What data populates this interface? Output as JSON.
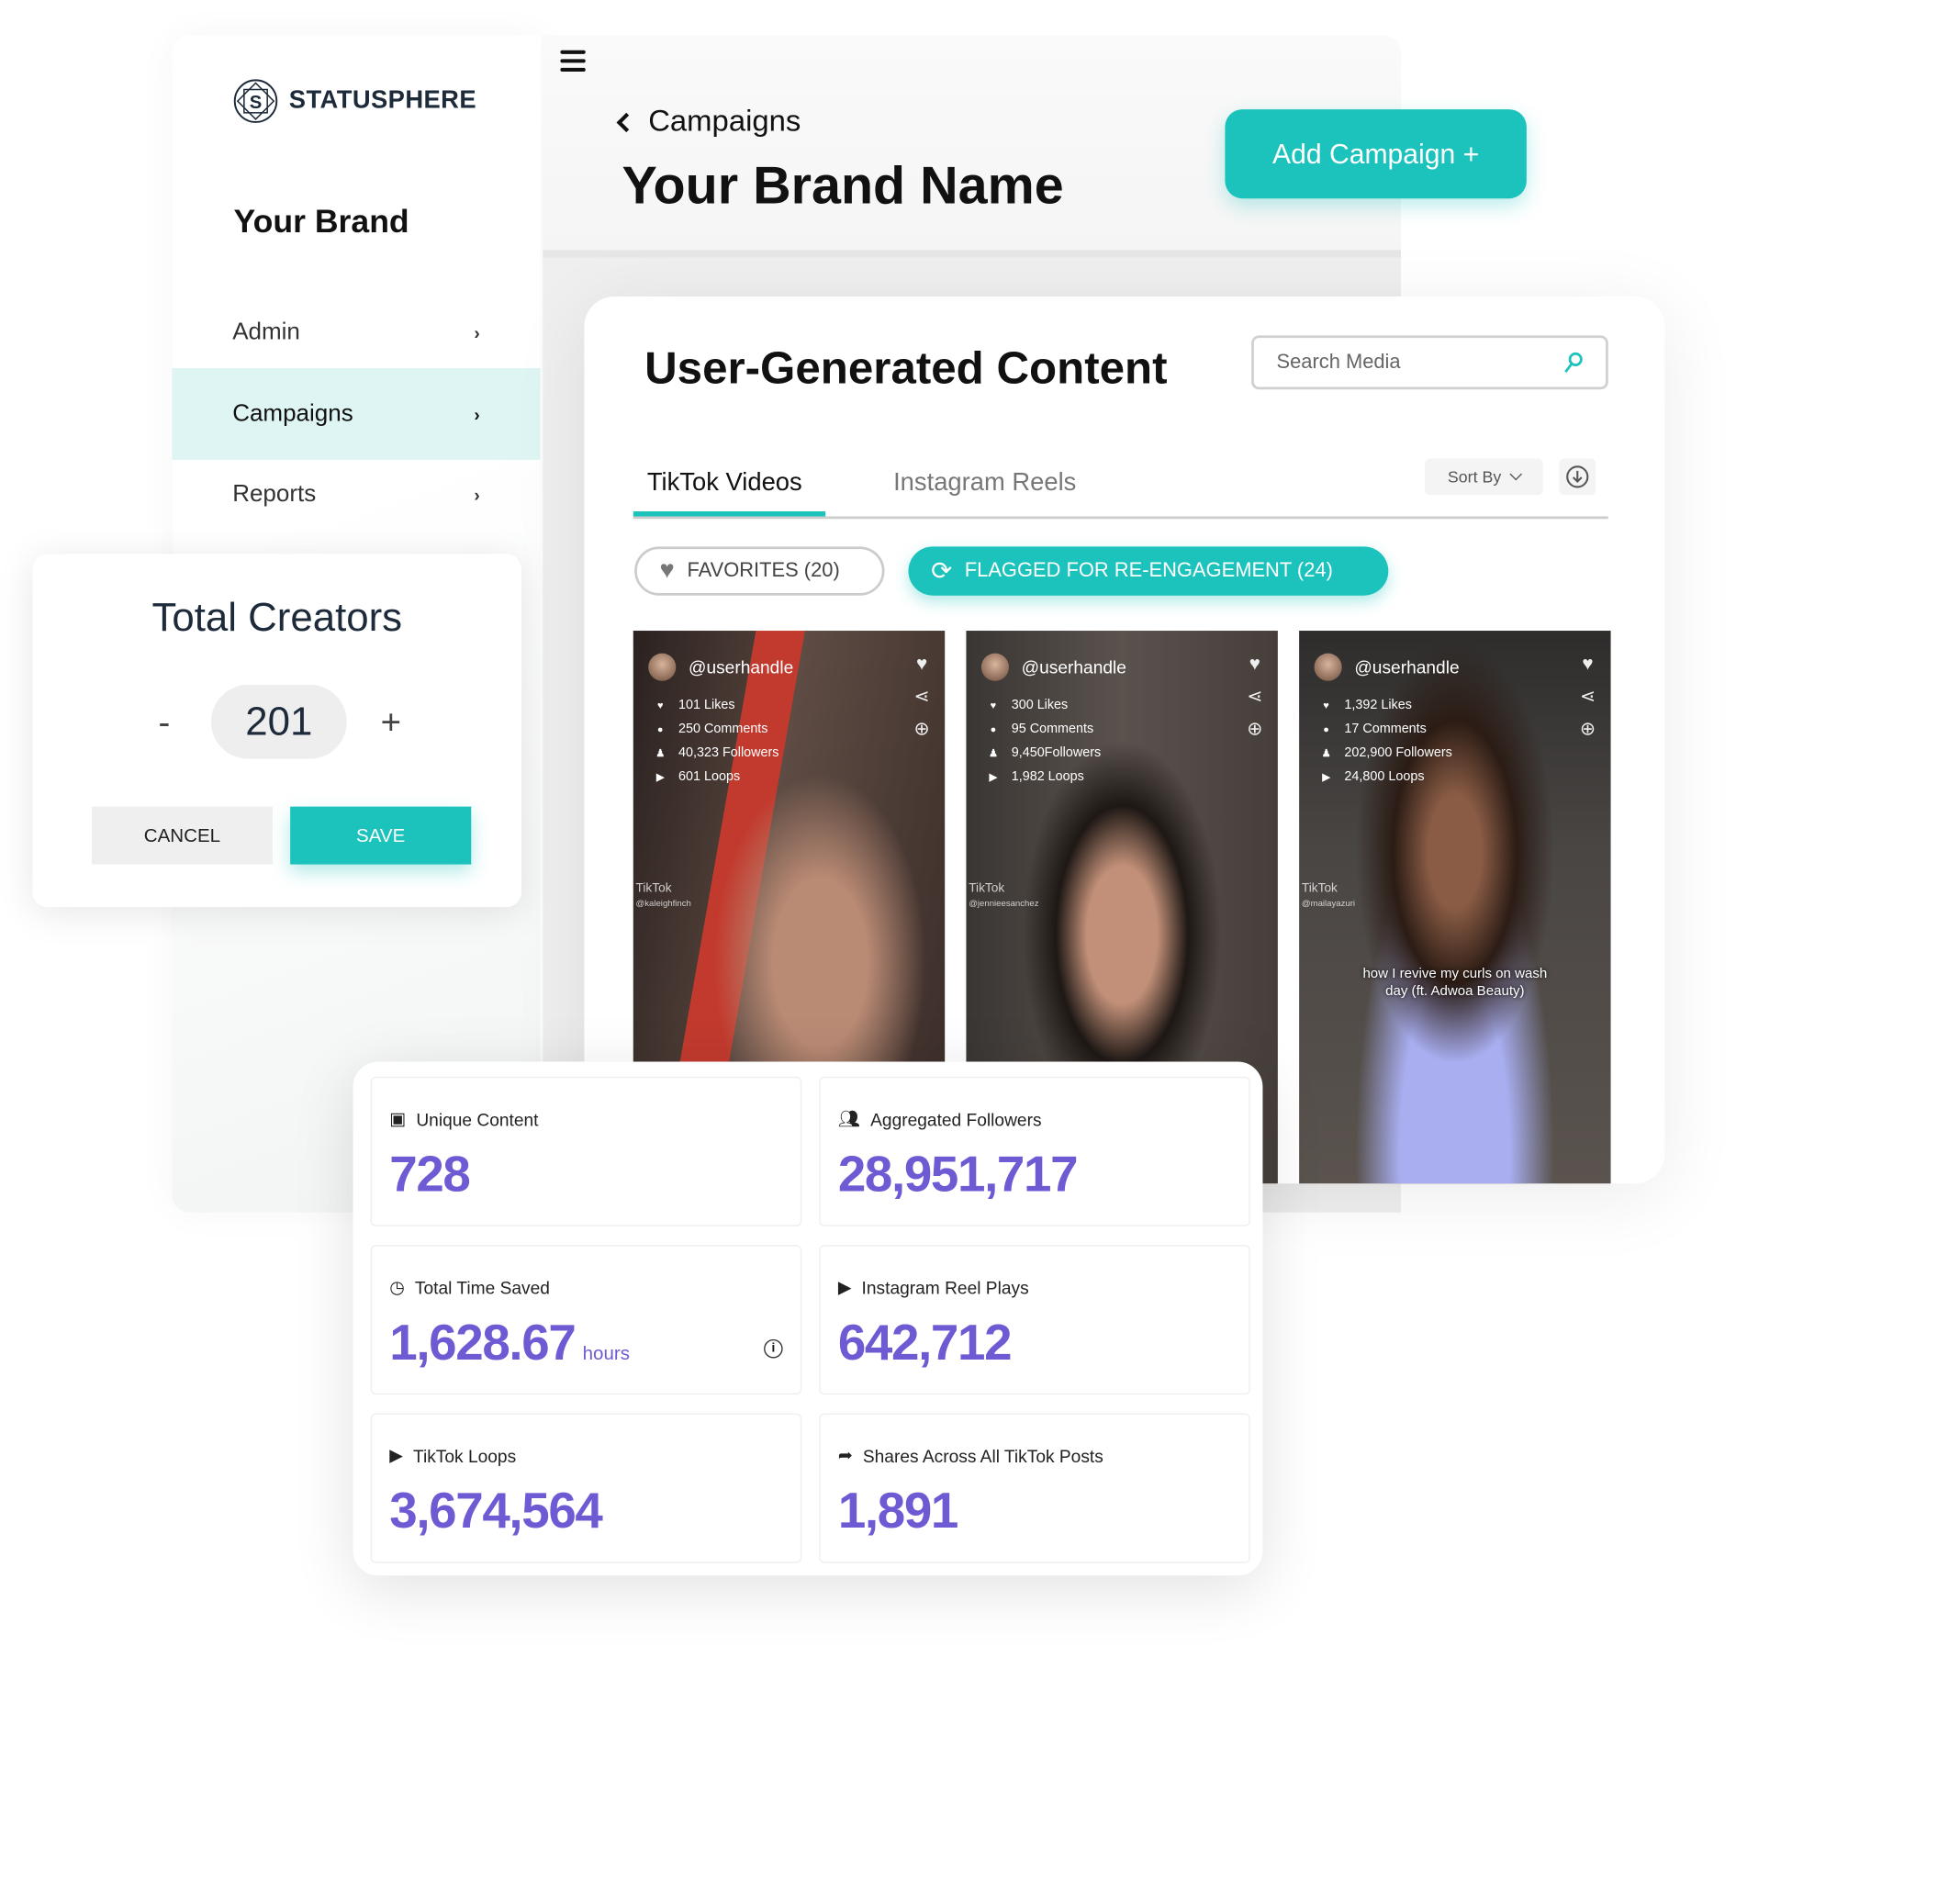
{
  "colors": {
    "accent": "#1cc3bc",
    "metric": "#6e5bd4",
    "nav_active_bg": "#dff5f4"
  },
  "app": {
    "logo_text": "STATUSPHERE",
    "logo_letter": "S",
    "menu_icon": "hamburger-icon"
  },
  "sidebar": {
    "brand": "Your Brand",
    "items": [
      {
        "label": "Admin"
      },
      {
        "label": "Campaigns",
        "active": true
      },
      {
        "label": "Reports"
      }
    ],
    "chevron": "›"
  },
  "header": {
    "breadcrumb": "Campaigns",
    "title": "Your Brand Name",
    "add_button": "Add Campaign +"
  },
  "creators": {
    "title": "Total Creators",
    "minus": "-",
    "value": "201",
    "plus": "+",
    "cancel": "CANCEL",
    "save": "SAVE"
  },
  "ugc": {
    "title": "User-Generated Content",
    "search_placeholder": "Search Media",
    "tabs": [
      {
        "label": "TikTok Videos",
        "active": true
      },
      {
        "label": "Instagram Reels"
      }
    ],
    "sort": "Sort By",
    "filters": [
      {
        "label": "FAVORITES (20)"
      },
      {
        "label": "FLAGGED FOR RE-ENGAGEMENT (24)",
        "active": true
      }
    ],
    "videos": [
      {
        "handle": "@userhandle",
        "likes": "101 Likes",
        "comments": "250 Comments",
        "followers": "40,323 Followers",
        "loops": "601 Loops",
        "watermark": "TikTok",
        "watermark_handle": "@kaleighfinch"
      },
      {
        "handle": "@userhandle",
        "likes": "300 Likes",
        "comments": "95 Comments",
        "followers": "9,450Followers",
        "loops": "1,982 Loops",
        "watermark": "TikTok",
        "watermark_handle": "@jennieesanchez"
      },
      {
        "handle": "@userhandle",
        "likes": "1,392 Likes",
        "comments": "17 Comments",
        "followers": "202,900 Followers",
        "loops": "24,800 Loops",
        "watermark": "TikTok",
        "watermark_handle": "@mailayazuri",
        "caption": "how I revive my curls on wash day (ft. Adwoa Beauty)"
      }
    ]
  },
  "metrics": [
    {
      "label": "Unique Content",
      "value": "728",
      "icon": "image-stack-icon"
    },
    {
      "label": "Aggregated Followers",
      "value": "28,951,717",
      "icon": "people-icon"
    },
    {
      "label": "Total Time Saved",
      "value": "1,628.67",
      "unit": "hours",
      "icon": "clock-plus-icon"
    },
    {
      "label": "Instagram Reel Plays",
      "value": "642,712",
      "icon": "play-icon"
    },
    {
      "label": "TikTok Loops",
      "value": "3,674,564",
      "icon": "play-icon"
    },
    {
      "label": "Shares Across All TikTok Posts",
      "value": "1,891",
      "icon": "share-arrow-icon"
    }
  ]
}
